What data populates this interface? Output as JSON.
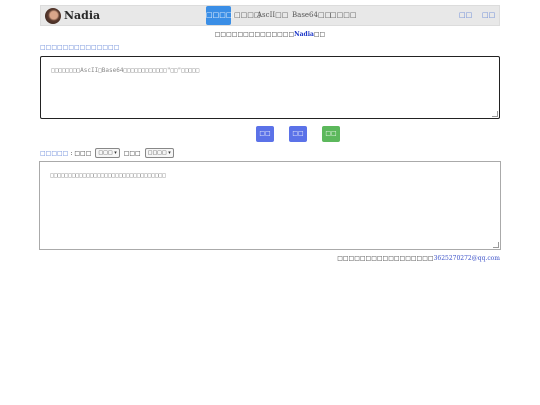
{
  "header": {
    "brand": "Nadia",
    "nav": [
      {
        "label": "□□□□□",
        "active": true
      },
      {
        "label": "□□□□",
        "active": false
      },
      {
        "label": "AscII□□",
        "active": false
      },
      {
        "label": "Base64□□",
        "active": false
      },
      {
        "label": "□□□□",
        "active": false
      }
    ],
    "right_links": [
      "□□",
      "□□"
    ]
  },
  "notice": {
    "prefix": "□□□□□□□□□□□□□□",
    "name": "Nadia",
    "suffix": "□□"
  },
  "hint": "□□□□□□□□□□□□□□",
  "input": {
    "placeholder": "□□□□□□□□AscII□Base64□□□□□□□□□□□□\"□□\"□□□□□"
  },
  "buttons": [
    {
      "label": "□□",
      "color": "#5b72e8"
    },
    {
      "label": "□□",
      "color": "#5b72e8"
    },
    {
      "label": "□□",
      "color": "#5cb85c"
    }
  ],
  "options": {
    "link_label": "□□□□□",
    "sep": ":",
    "label1": "□□□",
    "select1": "□□□",
    "label2": "□□□",
    "select2": "□□□□"
  },
  "output": {
    "placeholder": "□□□□□□□□□□□□□□□□□□□□□□□□□□□□□□□□"
  },
  "footer": {
    "text": "□□□□□□□□□□□□□□□□□",
    "email": "3625270272@qq.com"
  }
}
